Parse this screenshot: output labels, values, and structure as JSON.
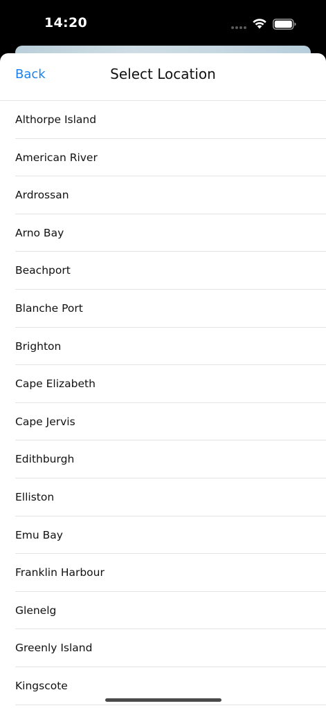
{
  "status_bar": {
    "time": "14:20",
    "wifi_icon": "wifi-icon",
    "battery_icon": "battery-icon"
  },
  "nav": {
    "back_label": "Back",
    "title": "Select Location"
  },
  "locations": [
    "Althorpe Island",
    "American River",
    "Ardrossan",
    "Arno Bay",
    "Beachport",
    "Blanche Port",
    "Brighton",
    "Cape Elizabeth",
    "Cape Jervis",
    "Edithburgh",
    "Elliston",
    "Emu Bay",
    "Franklin Harbour",
    "Glenelg",
    "Greenly Island",
    "Kingscote"
  ],
  "colors": {
    "accent": "#1a82f0",
    "text": "#111111",
    "separator": "#e3e3e6"
  }
}
